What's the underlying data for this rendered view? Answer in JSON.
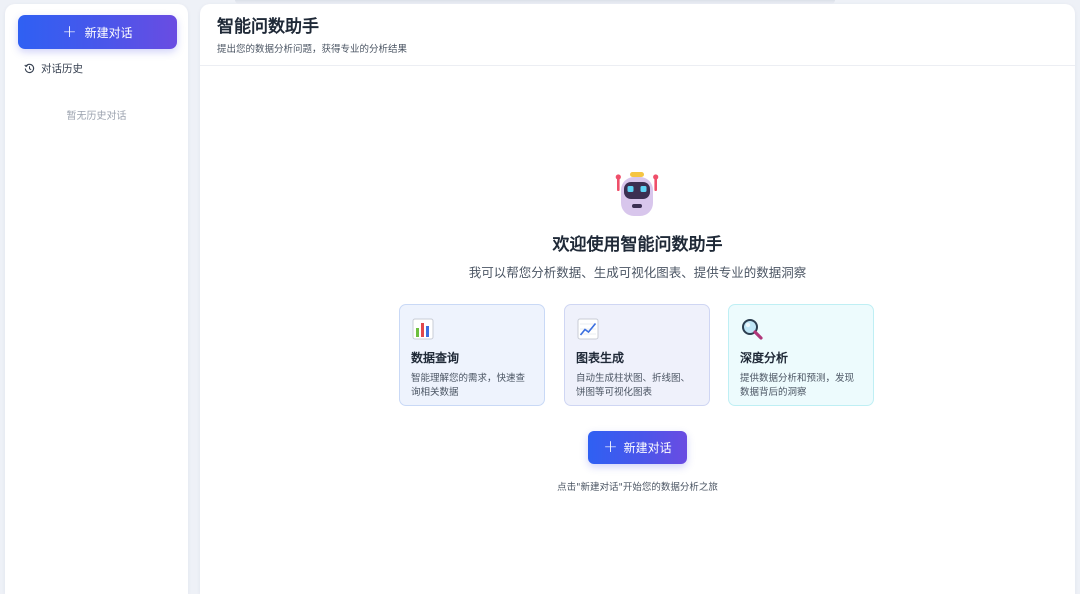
{
  "sidebar": {
    "new_chat_label": "新建对话",
    "history_title": "对话历史",
    "history_empty": "暂无历史对话"
  },
  "header": {
    "title": "智能问数助手",
    "subtitle": "提出您的数据分析问题，获得专业的分析结果"
  },
  "welcome": {
    "icon": "robot-icon",
    "title": "欢迎使用智能问数助手",
    "subtitle": "我可以帮您分析数据、生成可视化图表、提供专业的数据洞察",
    "features": [
      {
        "icon": "bar-chart-icon",
        "title": "数据查询",
        "desc": "智能理解您的需求，快速查询相关数据"
      },
      {
        "icon": "line-chart-icon",
        "title": "图表生成",
        "desc": "自动生成柱状图、折线图、饼图等可视化图表"
      },
      {
        "icon": "magnifier-icon",
        "title": "深度分析",
        "desc": "提供数据分析和预测，发现数据背后的洞察"
      }
    ],
    "start_label": "新建对话",
    "hint": "点击\"新建对话\"开始您的数据分析之旅"
  },
  "colors": {
    "accent_start": "#2f60f3",
    "accent_end": "#6a4ce2",
    "background": "#eef1f7"
  }
}
